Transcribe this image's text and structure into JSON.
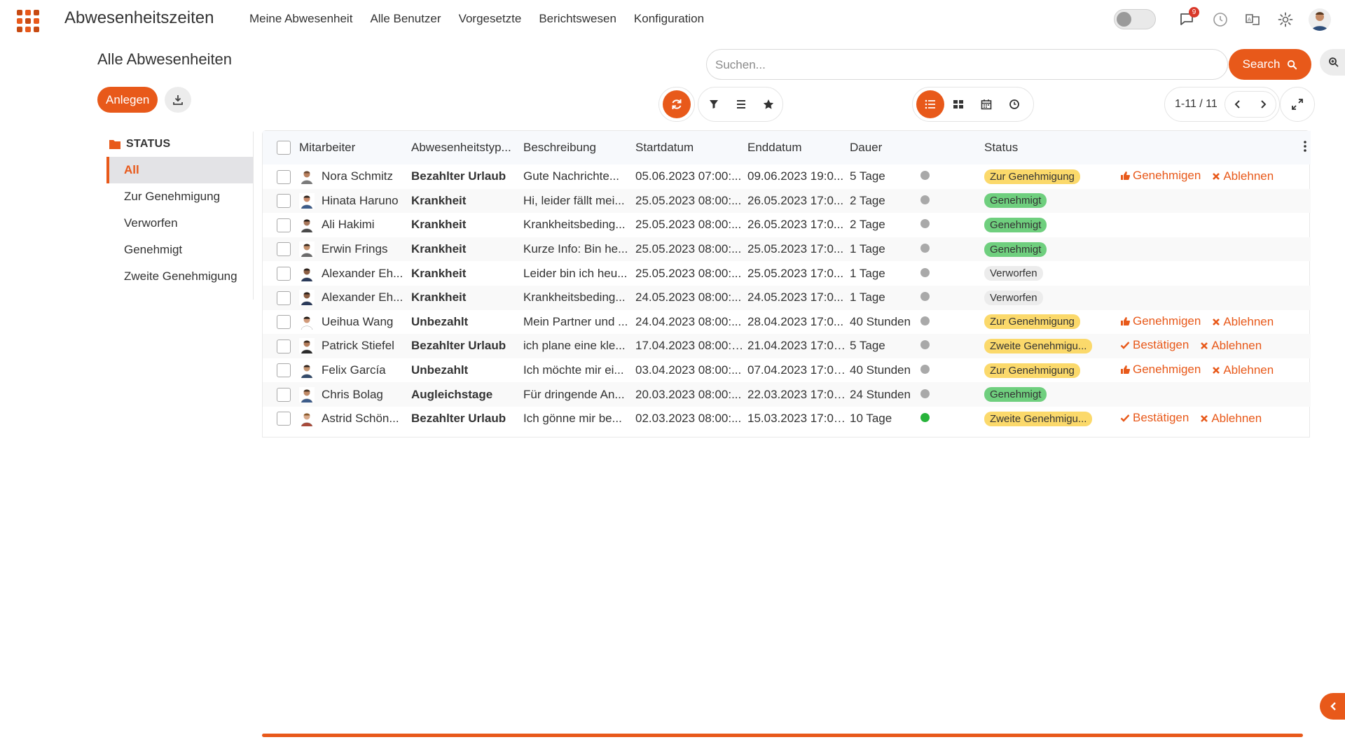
{
  "app": {
    "title": "Abwesenheitszeiten"
  },
  "menu": [
    "Meine Abwesenheit",
    "Alle Benutzer",
    "Vorgesetzte",
    "Berichtswesen",
    "Konfiguration"
  ],
  "notifications": {
    "count": "9"
  },
  "page": {
    "title": "Alle Abwesenheiten",
    "create_label": "Anlegen"
  },
  "search": {
    "placeholder": "Suchen...",
    "button_label": "Search"
  },
  "pager": {
    "text": "1-11 / 11"
  },
  "sidebar": {
    "heading": "STATUS",
    "items": [
      "All",
      "Zur Genehmigung",
      "Verworfen",
      "Genehmigt",
      "Zweite Genehmigung"
    ]
  },
  "table": {
    "headers": {
      "employee": "Mitarbeiter",
      "type": "Abwesenheitstyp...",
      "description": "Beschreibung",
      "start": "Startdatum",
      "end": "Enddatum",
      "duration": "Dauer",
      "status": "Status"
    },
    "rows": [
      {
        "employee": "Nora Schmitz",
        "type": "Bezahlter Urlaub",
        "description": "Gute Nachrichte...",
        "start": "05.06.2023 07:00:...",
        "end": "09.06.2023 19:0...",
        "duration": "5 Tage",
        "dot": "gray",
        "status": "Zur Genehmigung",
        "status_kind": "pending",
        "actions": [
          "Genehmigen",
          "Ablehnen"
        ]
      },
      {
        "employee": "Hinata Haruno",
        "type": "Krankheit",
        "description": "Hi, leider fällt mei...",
        "start": "25.05.2023 08:00:...",
        "end": "26.05.2023 17:0...",
        "duration": "2 Tage",
        "dot": "gray",
        "status": "Genehmigt",
        "status_kind": "approved",
        "actions": []
      },
      {
        "employee": "Ali Hakimi",
        "type": "Krankheit",
        "description": "Krankheitsbeding...",
        "start": "25.05.2023 08:00:...",
        "end": "26.05.2023 17:0...",
        "duration": "2 Tage",
        "dot": "gray",
        "status": "Genehmigt",
        "status_kind": "approved",
        "actions": []
      },
      {
        "employee": "Erwin Frings",
        "type": "Krankheit",
        "description": "Kurze Info: Bin he...",
        "start": "25.05.2023 08:00:...",
        "end": "25.05.2023 17:0...",
        "duration": "1 Tage",
        "dot": "gray",
        "status": "Genehmigt",
        "status_kind": "approved",
        "actions": []
      },
      {
        "employee": "Alexander Eh...",
        "type": "Krankheit",
        "description": "Leider bin ich heu...",
        "start": "25.05.2023 08:00:...",
        "end": "25.05.2023 17:0...",
        "duration": "1 Tage",
        "dot": "gray",
        "status": "Verworfen",
        "status_kind": "rejected",
        "actions": []
      },
      {
        "employee": "Alexander Eh...",
        "type": "Krankheit",
        "description": "Krankheitsbeding...",
        "start": "24.05.2023 08:00:...",
        "end": "24.05.2023 17:0...",
        "duration": "1 Tage",
        "dot": "gray",
        "status": "Verworfen",
        "status_kind": "rejected",
        "actions": []
      },
      {
        "employee": "Ueihua Wang",
        "type": "Unbezahlt",
        "description": "Mein Partner und ...",
        "start": "24.04.2023 08:00:...",
        "end": "28.04.2023 17:0...",
        "duration": "40 Stunden",
        "dot": "gray",
        "status": "Zur Genehmigung",
        "status_kind": "pending",
        "actions": [
          "Genehmigen",
          "Ablehnen"
        ]
      },
      {
        "employee": "Patrick Stiefel",
        "type": "Bezahlter Urlaub",
        "description": "ich plane eine kle...",
        "start": "17.04.2023 08:00:0...",
        "end": "21.04.2023 17:00:...",
        "duration": "5 Tage",
        "dot": "gray",
        "status": "Zweite Genehmigu...",
        "status_kind": "second",
        "actions": [
          "Bestätigen",
          "Ablehnen"
        ]
      },
      {
        "employee": "Felix García",
        "type": "Unbezahlt",
        "description": "Ich möchte mir ei...",
        "start": "03.04.2023 08:00:...",
        "end": "07.04.2023 17:00...",
        "duration": "40 Stunden",
        "dot": "gray",
        "status": "Zur Genehmigung",
        "status_kind": "pending",
        "actions": [
          "Genehmigen",
          "Ablehnen"
        ]
      },
      {
        "employee": "Chris Bolag",
        "type": "Augleichstage",
        "description": "Für dringende An...",
        "start": "20.03.2023 08:00:...",
        "end": "22.03.2023 17:00...",
        "duration": "24 Stunden",
        "dot": "gray",
        "status": "Genehmigt",
        "status_kind": "approved",
        "actions": []
      },
      {
        "employee": "Astrid Schön...",
        "type": "Bezahlter Urlaub",
        "description": "Ich gönne mir be...",
        "start": "02.03.2023 08:00:...",
        "end": "15.03.2023 17:00:...",
        "duration": "10 Tage",
        "dot": "green",
        "status": "Zweite Genehmigu...",
        "status_kind": "second",
        "actions": [
          "Bestätigen",
          "Ablehnen"
        ]
      }
    ]
  },
  "colors": {
    "accent": "#e8591a",
    "approved": "#6fcf7e",
    "pending": "#fbd96b"
  }
}
